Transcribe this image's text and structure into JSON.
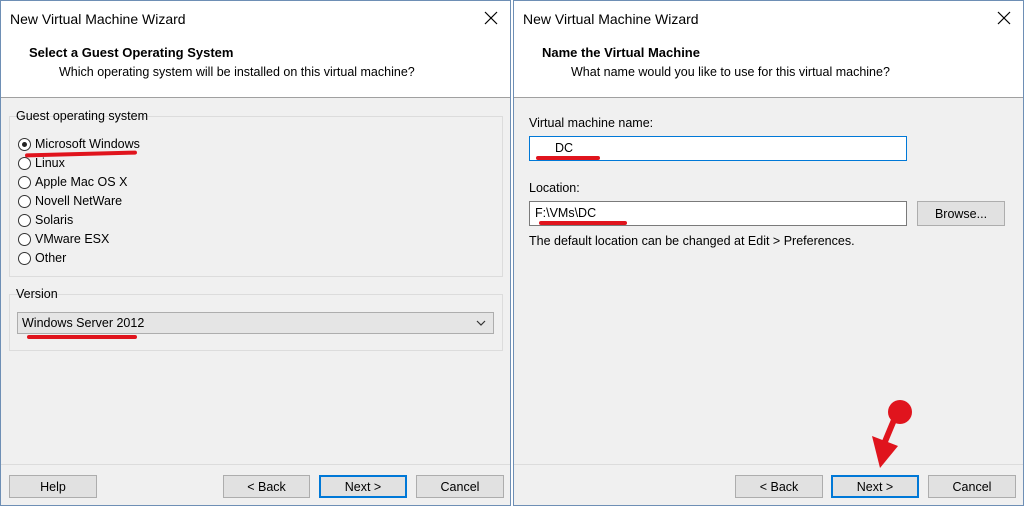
{
  "left_window": {
    "title": "New Virtual Machine Wizard",
    "header_title": "Select a Guest Operating System",
    "header_subtitle": "Which operating system will be installed on this virtual machine?",
    "guest_os_group_label": "Guest operating system",
    "os_options": [
      {
        "label": "Microsoft Windows",
        "selected": true
      },
      {
        "label": "Linux",
        "selected": false
      },
      {
        "label": "Apple Mac OS X",
        "selected": false
      },
      {
        "label": "Novell NetWare",
        "selected": false
      },
      {
        "label": "Solaris",
        "selected": false
      },
      {
        "label": "VMware ESX",
        "selected": false
      },
      {
        "label": "Other",
        "selected": false
      }
    ],
    "version_group_label": "Version",
    "version_selected": "Windows Server 2012",
    "buttons": {
      "help": "Help",
      "back": "< Back",
      "next": "Next >",
      "cancel": "Cancel"
    }
  },
  "right_window": {
    "title": "New Virtual Machine Wizard",
    "header_title": "Name the Virtual Machine",
    "header_subtitle": "What name would you like to use for this virtual machine?",
    "vm_name_label": "Virtual machine name:",
    "vm_name_value": "DC",
    "location_label": "Location:",
    "location_value": "F:\\VMs\\DC",
    "browse_label": "Browse...",
    "hint": "The default location can be changed at Edit > Preferences.",
    "buttons": {
      "back": "< Back",
      "next": "Next >",
      "cancel": "Cancel"
    }
  },
  "annotation_color": "#e0141d",
  "icons": {
    "close": "close-icon",
    "dropdown": "chevron-down-icon",
    "radio": "radio-icon",
    "pointer": "red-arrow-annotation-icon"
  }
}
